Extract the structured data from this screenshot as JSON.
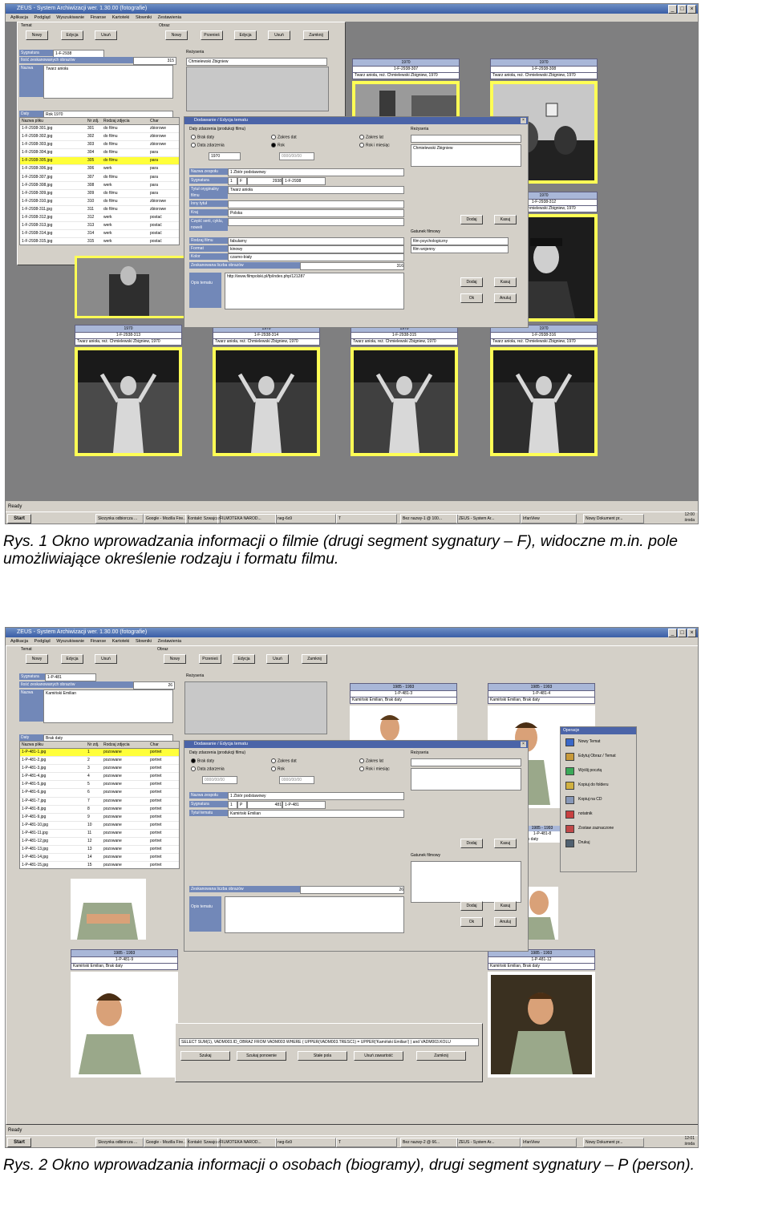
{
  "screenshot1": {
    "window_title": "ZEUS - System Archiwizacji wer. 1.30.00 (fotografie)",
    "menu": [
      "Aplikacja",
      "Podgląd",
      "Wyszukiwanie",
      "Finanse",
      "Kartoteki",
      "Słowniki",
      "Zestawienia"
    ],
    "group_temat": "Temat",
    "group_obraz": "Obraz",
    "buttons_temat": [
      "Nowy",
      "Edycja",
      "Usuń"
    ],
    "buttons_obraz": [
      "Nowy",
      "Przenieś",
      "Edycja",
      "Usuń",
      "Zamknij"
    ],
    "info": {
      "sygnatura_label": "Sygnatura",
      "sygnatura_value": "1-F-2938",
      "ilosc_label": "Ilość zeskanowanych obrazów",
      "ilosc_value": "315",
      "nazwa_label": "Nazwa",
      "nazwa_value": "Twarz anioła",
      "daty_label": "Daty",
      "daty_value": "Rok 1970",
      "rezyseria_label": "Reżyseria",
      "rezyseria_value": "Chmielewski Zbigniew"
    },
    "table": {
      "columns": [
        "Nazwa pliku",
        "Nr zdj.",
        "Rodzaj zdjęcia",
        "Char"
      ],
      "rows": [
        [
          "1-F-2938-301.jpg",
          "301",
          "do filmu",
          "zbiorowe"
        ],
        [
          "1-F-2938-302.jpg",
          "302",
          "do filmu",
          "zbiorowe"
        ],
        [
          "1-F-2938-303.jpg",
          "303",
          "do filmu",
          "zbiorowe"
        ],
        [
          "1-F-2938-304.jpg",
          "304",
          "do filmu",
          "para"
        ],
        [
          "1-F-2938-305.jpg",
          "305",
          "do filmu",
          "para"
        ],
        [
          "1-F-2938-306.jpg",
          "306",
          "werk",
          "para"
        ],
        [
          "1-F-2938-307.jpg",
          "307",
          "do filmu",
          "para"
        ],
        [
          "1-F-2938-308.jpg",
          "308",
          "werk",
          "para"
        ],
        [
          "1-F-2938-309.jpg",
          "309",
          "do filmu",
          "para"
        ],
        [
          "1-F-2938-310.jpg",
          "310",
          "do filmu",
          "zbiorowe"
        ],
        [
          "1-F-2938-311.jpg",
          "311",
          "do filmu",
          "zbiorowe"
        ],
        [
          "1-F-2938-312.jpg",
          "312",
          "werk",
          "postać"
        ],
        [
          "1-F-2938-313.jpg",
          "313",
          "werk",
          "postać"
        ],
        [
          "1-F-2938-314.jpg",
          "314",
          "werk",
          "postać"
        ],
        [
          "1-F-2938-315.jpg",
          "315",
          "werk",
          "postać"
        ],
        [
          "1-F-2938-316.jpg",
          "316",
          "dokumentalne",
          "detal"
        ]
      ],
      "selected_index": 4
    },
    "dialog": {
      "title": "Dodawanie / Edycja tematu",
      "daty_group": "Daty zdarzenia (produkcji filmu)",
      "radio_brak": "Brak daty",
      "radio_zakres_dat": "Zakres dat",
      "radio_zakres_lat": "Zakres lat",
      "radio_data": "Data zdarzenia",
      "radio_rok": "Rok",
      "radio_rok_miesiac": "Rok i miesiąc",
      "year_value": "1970",
      "date_placeholder": "0000/00/00",
      "rezyseria_label": "Reżyseria",
      "rezyseria_value": "Chmielewski Zbigniew",
      "nazwa_zespolu_label": "Nazwa zespołu",
      "nazwa_zespolu_value": "1 Zbiór podstawowy",
      "sygnatura_label": "Sygnatura",
      "sygnatura_parts": [
        "1",
        "F",
        "2938",
        "1-F-2938"
      ],
      "tytul_label": "Tytuł oryginalny filmu",
      "tytul_value": "Twarz anioła",
      "inny_tytul_label": "Inny tytuł",
      "kraj_label": "Kraj",
      "kraj_value": "Polska",
      "czesc_label": "Część serii, cyklu, noweli",
      "gatunek_label": "Gatunek filmowy",
      "gatunek_values": [
        "film psychologiczny",
        "film wojenny"
      ],
      "rodzaj_label": "Rodzaj filmu",
      "rodzaj_value": "fabularny",
      "format_label": "Format",
      "format_value": "kinowy",
      "kolor_label": "Kolor",
      "kolor_value": "czarno-biały",
      "zeskanowana_label": "Zeskanowana liczba obrazów",
      "zeskanowana_value": "316",
      "opis_label": "Opis tematu",
      "opis_value": "http://www.filmpolski.pl/fp/index.php/121287",
      "btn_dodaj": "Dodaj",
      "btn_kasuj": "Kasuj",
      "btn_ok": "Ok",
      "btn_anuluj": "Anuluj"
    },
    "photos_top": [
      {
        "year": "1970",
        "sig": "1-F-2938-307",
        "desc": "Twarz anioła, reż. Chmielewski Zbigniew, 1970"
      },
      {
        "year": "1970",
        "sig": "1-F-2938-308",
        "desc": "Twarz anioła, reż. Chmielewski Zbigniew, 1970"
      }
    ],
    "photo_mid_right": {
      "year": "1970",
      "sig": "1-F-2938-312",
      "desc": "Twarz anioła, reż. Chmielewski Zbigniew, 1970"
    },
    "photos_bottom": [
      {
        "year": "1970",
        "sig": "1-F-2938-313",
        "desc": "Twarz anioła, reż. Chmielewski Zbigniew, 1970"
      },
      {
        "year": "1970",
        "sig": "1-F-2938-314",
        "desc": "Twarz anioła, reż. Chmielewski Zbigniew, 1970"
      },
      {
        "year": "1970",
        "sig": "1-F-2938-315",
        "desc": "Twarz anioła, reż. Chmielewski Zbigniew, 1970"
      },
      {
        "year": "1970",
        "sig": "1-F-2938-316",
        "desc": "Twarz anioła, reż. Chmielewski Zbigniew, 1970"
      }
    ],
    "status": "Ready",
    "taskbar": {
      "start": "Start",
      "tasks": [
        "Skrzynka odbiorcza ...",
        "Google - Mozilla Fire...",
        "Kontakt: Szwajcarsk...",
        "FILMOTEKA NAROD...",
        "neg-6x9",
        "T",
        "Bez nazwy-1 @ 100...",
        "ZEUS - System Ar...",
        "IrfanView",
        "Nowy Dokument pr..."
      ],
      "time": "12:00",
      "day": "środa"
    }
  },
  "caption1": "Rys. 1 Okno wprowadzania informacji o filmie (drugi segment sygnatury – F), widoczne m.in. pole umożliwiające określenie rodzaju i formatu filmu.",
  "screenshot2": {
    "window_title": "ZEUS - System Archiwizacji wer. 1.30.00 (fotografie)",
    "menu": [
      "Aplikacja",
      "Podgląd",
      "Wyszukiwanie",
      "Finanse",
      "Kartoteki",
      "Słowniki",
      "Zestawienia"
    ],
    "group_temat": "Temat",
    "group_obraz": "Obraz",
    "buttons_temat": [
      "Nowy",
      "Edycja",
      "Usuń"
    ],
    "buttons_obraz": [
      "Nowy",
      "Przenieś",
      "Edycja",
      "Usuń",
      "Zamknij"
    ],
    "info": {
      "sygnatura_label": "Sygnatura",
      "sygnatura_value": "1-P-481",
      "ilosc_label": "Ilość zeskanowanych obrazów",
      "ilosc_value": "26",
      "nazwa_label": "Nazwa",
      "nazwa_value": "Kamiński Emilian",
      "daty_label": "Daty",
      "daty_value": "Brak daty",
      "rezyseria_label": "Reżyseria"
    },
    "table": {
      "columns": [
        "Nazwa pliku",
        "Nr zdj.",
        "Rodzaj zdjęcia",
        "Char"
      ],
      "rows": [
        [
          "1-P-481-1.jpg",
          "1",
          "pozowane",
          "portret"
        ],
        [
          "1-P-481-2.jpg",
          "2",
          "pozowane",
          "portret"
        ],
        [
          "1-P-481-3.jpg",
          "3",
          "pozowane",
          "portret"
        ],
        [
          "1-P-481-4.jpg",
          "4",
          "pozowane",
          "portret"
        ],
        [
          "1-P-481-5.jpg",
          "5",
          "pozowane",
          "portret"
        ],
        [
          "1-P-481-6.jpg",
          "6",
          "pozowane",
          "portret"
        ],
        [
          "1-P-481-7.jpg",
          "7",
          "pozowane",
          "portret"
        ],
        [
          "1-P-481-8.jpg",
          "8",
          "pozowane",
          "portret"
        ],
        [
          "1-P-481-9.jpg",
          "9",
          "pozowane",
          "portret"
        ],
        [
          "1-P-481-10.jpg",
          "10",
          "pozowane",
          "portret"
        ],
        [
          "1-P-481-11.jpg",
          "11",
          "pozowane",
          "portret"
        ],
        [
          "1-P-481-12.jpg",
          "12",
          "pozowane",
          "portret"
        ],
        [
          "1-P-481-13.jpg",
          "13",
          "pozowane",
          "portret"
        ],
        [
          "1-P-481-14.jpg",
          "14",
          "pozowane",
          "portret"
        ],
        [
          "1-P-481-15.jpg",
          "15",
          "pozowane",
          "portret"
        ],
        [
          "1-P-481-16.jpg",
          "16",
          "pozowane",
          "portret"
        ]
      ],
      "selected_index": 0
    },
    "dialog": {
      "title": "Dodawanie / Edycja tematu",
      "daty_group": "Daty zdarzenia (produkcji filmu)",
      "radio_brak": "Brak daty",
      "radio_zakres_dat": "Zakres dat",
      "radio_zakres_lat": "Zakres lat",
      "radio_data": "Data zdarzenia",
      "radio_rok": "Rok",
      "radio_rok_miesiac": "Rok i miesiąc",
      "date_placeholder": "0000/00/00",
      "rezyseria_label": "Reżyseria",
      "nazwa_zespolu_label": "Nazwa zespołu",
      "nazwa_zespolu_value": "1 Zbiór podstawowy",
      "sygnatura_label": "Sygnatura",
      "sygnatura_parts": [
        "1",
        "P",
        "481",
        "1-P-481"
      ],
      "tytul_label": "Tytuł tematu",
      "tytul_value": "Kamiński Emilian",
      "gatunek_label": "Gatunek filmowy",
      "zeskanowana_label": "Zeskanowana liczba obrazów",
      "zeskanowana_value": "26",
      "opis_label": "Opis tematu",
      "btn_dodaj": "Dodaj",
      "btn_kasuj": "Kasuj",
      "btn_ok": "Ok",
      "btn_anuluj": "Anuluj"
    },
    "operations": {
      "title": "Operacje",
      "items": [
        "Nowy Temat",
        "Edytuj Obraz / Temat",
        "Wyślij pocztą",
        "Kopiuj do folderu",
        "Kopiuj na CD",
        "notatnik",
        "Zostaw zaznaczone",
        "Drukuj"
      ]
    },
    "photos_top": [
      {
        "year": "1985 - 1993",
        "sig": "1-P-481-3",
        "desc": "Kamiński Emilian, Brak daty"
      },
      {
        "year": "1985 - 1993",
        "sig": "1-P-481-4",
        "desc": "Kamiński Emilian, Brak daty"
      }
    ],
    "photo_mid_right": {
      "year": "1985 - 1993",
      "sig": "1-P-481-8",
      "desc": "Brak daty"
    },
    "photos_bottom": [
      {
        "year": "1985 - 1993",
        "sig": "1-P-481-9",
        "desc": "Kamiński Emilian, Brak daty"
      },
      {
        "year": "1985 - 1993",
        "sig": "1-P-481-12",
        "desc": "Kamiński Emilian, Brak daty"
      }
    ],
    "sql": "SELECT SUM(1), VADM003.ID_OBRAZ FROM VADM003 WHERE ( UPPER(VADM003.TRESC1) = UPPER('Kamiński Emilian') ) and VADM003.KOLU",
    "search_buttons": [
      "Szukaj",
      "Szukaj ponownie",
      "Stałe pola",
      "Usuń zawartość",
      "Zamknij"
    ],
    "status": "Ready",
    "taskbar": {
      "start": "Start",
      "tasks": [
        "Skrzynka odbiorcza ...",
        "Google - Mozilla Fire...",
        "Kontakt: Szwajcarsk...",
        "FILMOTEKA NAROD...",
        "neg-6x9",
        "T",
        "Bez nazwy-2 @ 66...",
        "ZEUS - System Ar...",
        "IrfanView",
        "Nowy Dokument pr..."
      ],
      "time": "12:01",
      "day": "środa"
    }
  },
  "caption2": "Rys. 2 Okno wprowadzania informacji o osobach (biogramy), drugi segment sygnatury – P (person).",
  "colors": {
    "accent_blue": "#4b64a8",
    "highlight_yellow": "#ffff3a",
    "photo_frame": "#ffff55",
    "workspace_gray": "#7f7f80"
  }
}
